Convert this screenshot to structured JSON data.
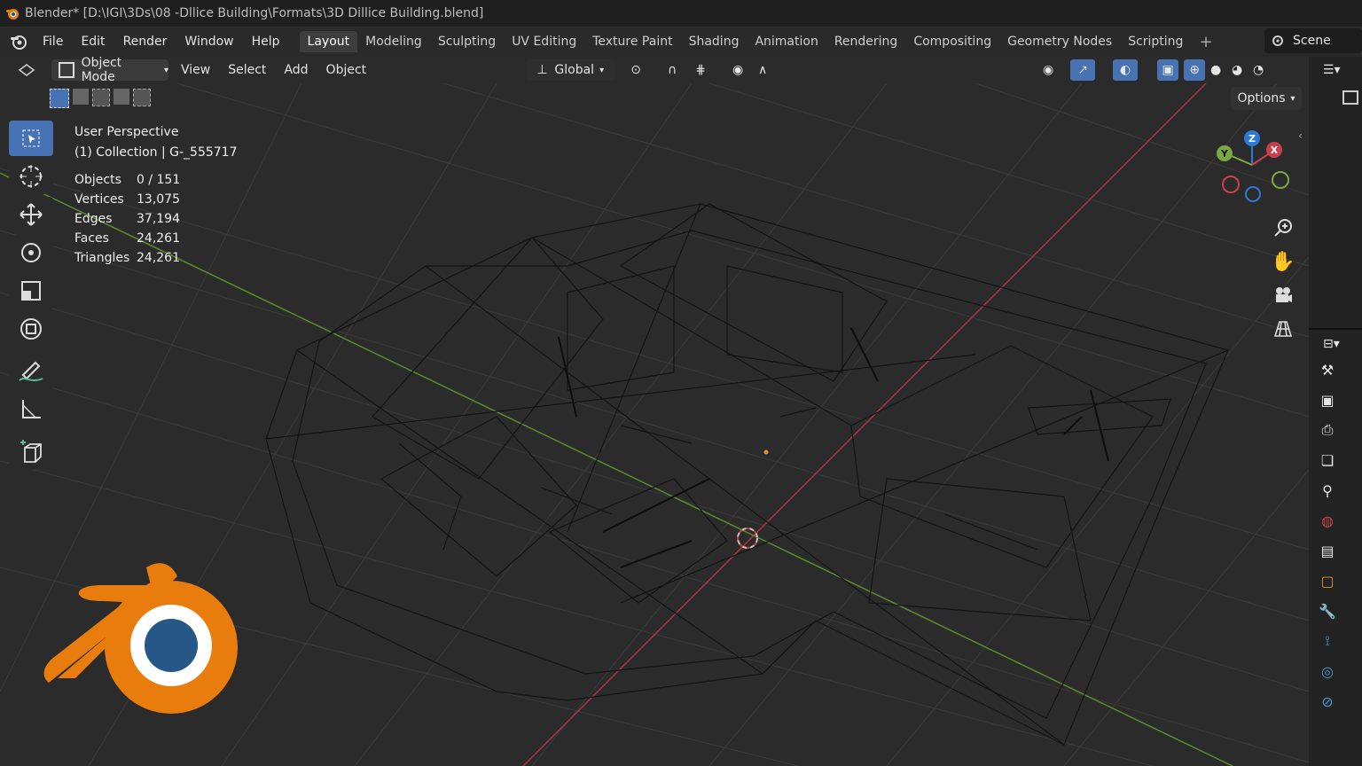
{
  "window_title": "Blender* [D:\\IGI\\3Ds\\08 -Dllice Building\\Formats\\3D Dillice Building.blend]",
  "menu": [
    "File",
    "Edit",
    "Render",
    "Window",
    "Help"
  ],
  "workspace_tabs": [
    {
      "label": "Layout",
      "active": true
    },
    {
      "label": "Modeling",
      "active": false
    },
    {
      "label": "Sculpting",
      "active": false
    },
    {
      "label": "UV Editing",
      "active": false
    },
    {
      "label": "Texture Paint",
      "active": false
    },
    {
      "label": "Shading",
      "active": false
    },
    {
      "label": "Animation",
      "active": false
    },
    {
      "label": "Rendering",
      "active": false
    },
    {
      "label": "Compositing",
      "active": false
    },
    {
      "label": "Geometry Nodes",
      "active": false
    },
    {
      "label": "Scripting",
      "active": false
    }
  ],
  "scene_name": "Scene",
  "header3d": {
    "mode": "Object Mode",
    "menus": [
      "View",
      "Select",
      "Add",
      "Object"
    ],
    "transform_orientation": "Global",
    "options_label": "Options"
  },
  "viewport_overlay": {
    "perspective": "User Perspective",
    "collection": "(1) Collection | G-_555717",
    "stats": [
      {
        "label": "Objects",
        "value": "0 / 151"
      },
      {
        "label": "Vertices",
        "value": "13,075"
      },
      {
        "label": "Edges",
        "value": "37,194"
      },
      {
        "label": "Faces",
        "value": "24,261"
      },
      {
        "label": "Triangles",
        "value": "24,261"
      }
    ]
  },
  "gizmo": {
    "x_label": "X",
    "y_label": "Y",
    "z_label": "Z"
  },
  "colors": {
    "active_tool": "#4772b3",
    "axis_x": "#c9404a",
    "axis_y": "#7aa843",
    "axis_z": "#2f79d6",
    "blender_orange": "#e87d0d",
    "blender_blue": "#265787"
  },
  "icons": {
    "tools": [
      "select-box-icon",
      "cursor-icon",
      "move-icon",
      "rotate-icon",
      "scale-icon",
      "transform-icon",
      "annotate-icon",
      "measure-icon",
      "add-cube-icon"
    ],
    "nav": [
      "zoom-icon",
      "pan-hand-icon",
      "camera-icon",
      "grid-icon"
    ]
  }
}
